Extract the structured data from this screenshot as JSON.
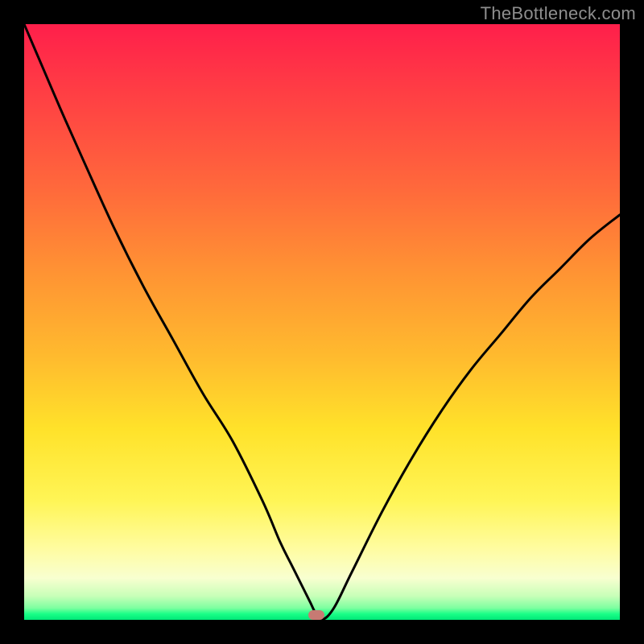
{
  "watermark": "TheBottleneck.com",
  "chart_data": {
    "type": "line",
    "title": "",
    "xlabel": "",
    "ylabel": "",
    "xlim": [
      0,
      100
    ],
    "ylim": [
      0,
      100
    ],
    "grid": false,
    "legend": false,
    "background": {
      "type": "vertical-gradient",
      "stops": [
        {
          "pos": 0,
          "color": "#ff1f4b"
        },
        {
          "pos": 10,
          "color": "#ff3a45"
        },
        {
          "pos": 28,
          "color": "#ff6a3b"
        },
        {
          "pos": 42,
          "color": "#ff9433"
        },
        {
          "pos": 56,
          "color": "#ffbb2e"
        },
        {
          "pos": 68,
          "color": "#ffe22a"
        },
        {
          "pos": 80,
          "color": "#fff556"
        },
        {
          "pos": 88,
          "color": "#fffca0"
        },
        {
          "pos": 93,
          "color": "#f8ffd0"
        },
        {
          "pos": 96,
          "color": "#c8ffb8"
        },
        {
          "pos": 98,
          "color": "#7effa0"
        },
        {
          "pos": 99,
          "color": "#1aff87"
        },
        {
          "pos": 100,
          "color": "#00e878"
        }
      ]
    },
    "series": [
      {
        "name": "bottleneck-curve",
        "color": "#000000",
        "x": [
          0,
          3,
          6,
          10,
          15,
          20,
          25,
          30,
          35,
          40,
          43,
          45,
          47,
          48,
          49,
          50,
          52,
          55,
          60,
          65,
          70,
          75,
          80,
          85,
          90,
          95,
          100
        ],
        "y": [
          100,
          93,
          86,
          77,
          66,
          56,
          47,
          38,
          30,
          20,
          13,
          9,
          5,
          3,
          1,
          0,
          2,
          8,
          18,
          27,
          35,
          42,
          48,
          54,
          59,
          64,
          68
        ]
      }
    ],
    "marker": {
      "x": 49,
      "y": 0.5,
      "color": "#c77a73"
    },
    "frame_color": "#000000"
  }
}
